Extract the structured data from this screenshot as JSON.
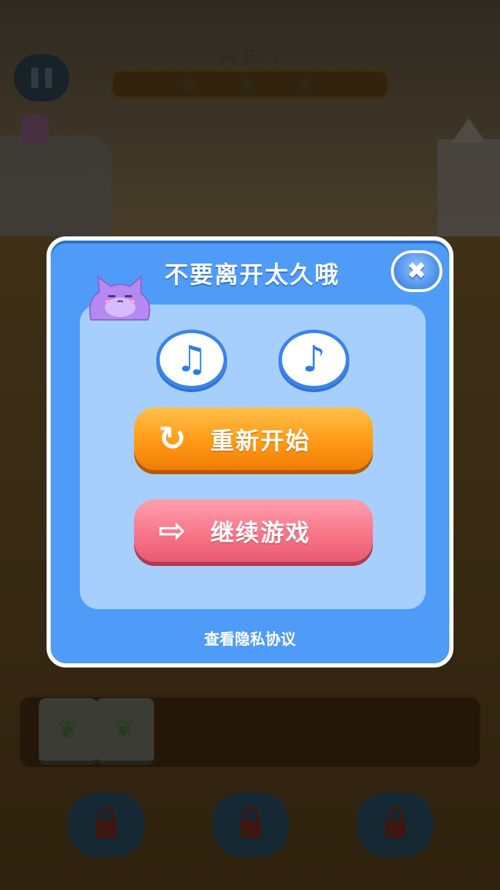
{
  "hud": {
    "level_label": "关卡: 1",
    "stars_total": 3,
    "stars_earned": 0
  },
  "dialog": {
    "title": "不要离开太久哦",
    "close_icon": "close-icon",
    "music_icon": "♫",
    "sound_icon": "♪",
    "restart_label": "重新开始",
    "restart_icon": "↻",
    "continue_label": "继续游戏",
    "continue_icon": "⇨",
    "privacy_label": "查看隐私协议"
  },
  "colors": {
    "dialog_bg": "#4f9bf8",
    "panel_bg": "#a6cffe",
    "restart_btn": "#ff9a16",
    "continue_btn": "#f87689"
  }
}
